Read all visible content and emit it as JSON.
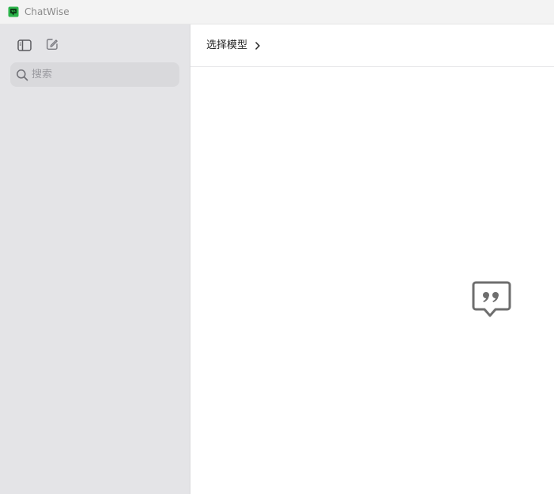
{
  "window": {
    "title": "ChatWise",
    "app_icon": "chatwise-logo-icon",
    "brand_color": "#2bb34a"
  },
  "sidebar": {
    "toggle_icon": "sidebar-toggle-icon",
    "new_chat_icon": "compose-icon",
    "search": {
      "icon": "search-icon",
      "placeholder": "搜索",
      "value": ""
    }
  },
  "main": {
    "model_selector": {
      "label": "选择模型",
      "icon": "chevron-right-icon"
    },
    "empty_state_icon": "quote-bubble-icon"
  }
}
